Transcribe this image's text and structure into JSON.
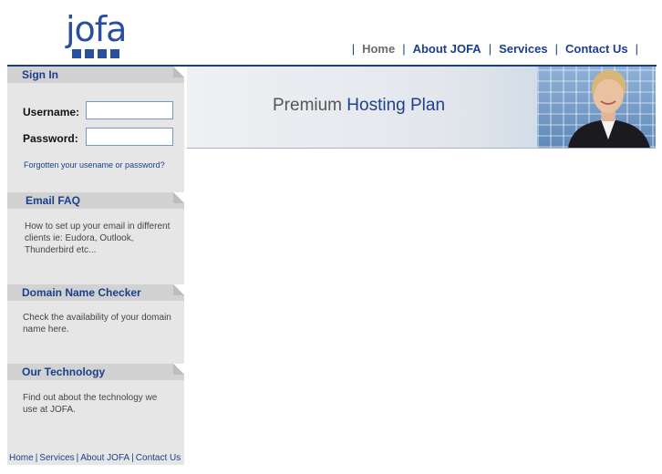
{
  "brand": {
    "logo_text": "jofa"
  },
  "topnav": [
    {
      "label": "Home"
    },
    {
      "label": "About JOFA"
    },
    {
      "label": "Services"
    },
    {
      "label": "Contact Us"
    }
  ],
  "signin": {
    "title": "Sign In",
    "username_label": "Username:",
    "password_label": "Password:",
    "username_value": "",
    "password_value": "",
    "forgot_link": "Forgotten your usename or password?"
  },
  "panels": [
    {
      "title": "Email FAQ",
      "text": "How to set up your email in different clients ie: Eudora, Outlook, Thunderbird etc..."
    },
    {
      "title": "Domain Name Checker",
      "text": "Check the availability of your domain name here."
    },
    {
      "title": "Our Technology",
      "text": "Find out about the technology we use at JOFA."
    }
  ],
  "footer_links": [
    {
      "label": "Home"
    },
    {
      "label": "Services"
    },
    {
      "label": "About JOFA"
    },
    {
      "label": "Contact Us"
    }
  ],
  "banner": {
    "title_prefix": "Premium ",
    "title_highlight": "Hosting Plan"
  },
  "colors": {
    "brand": "#1a3f8c",
    "sidebar": "#e6e6e6",
    "panel_header": "#d2d2d2"
  }
}
